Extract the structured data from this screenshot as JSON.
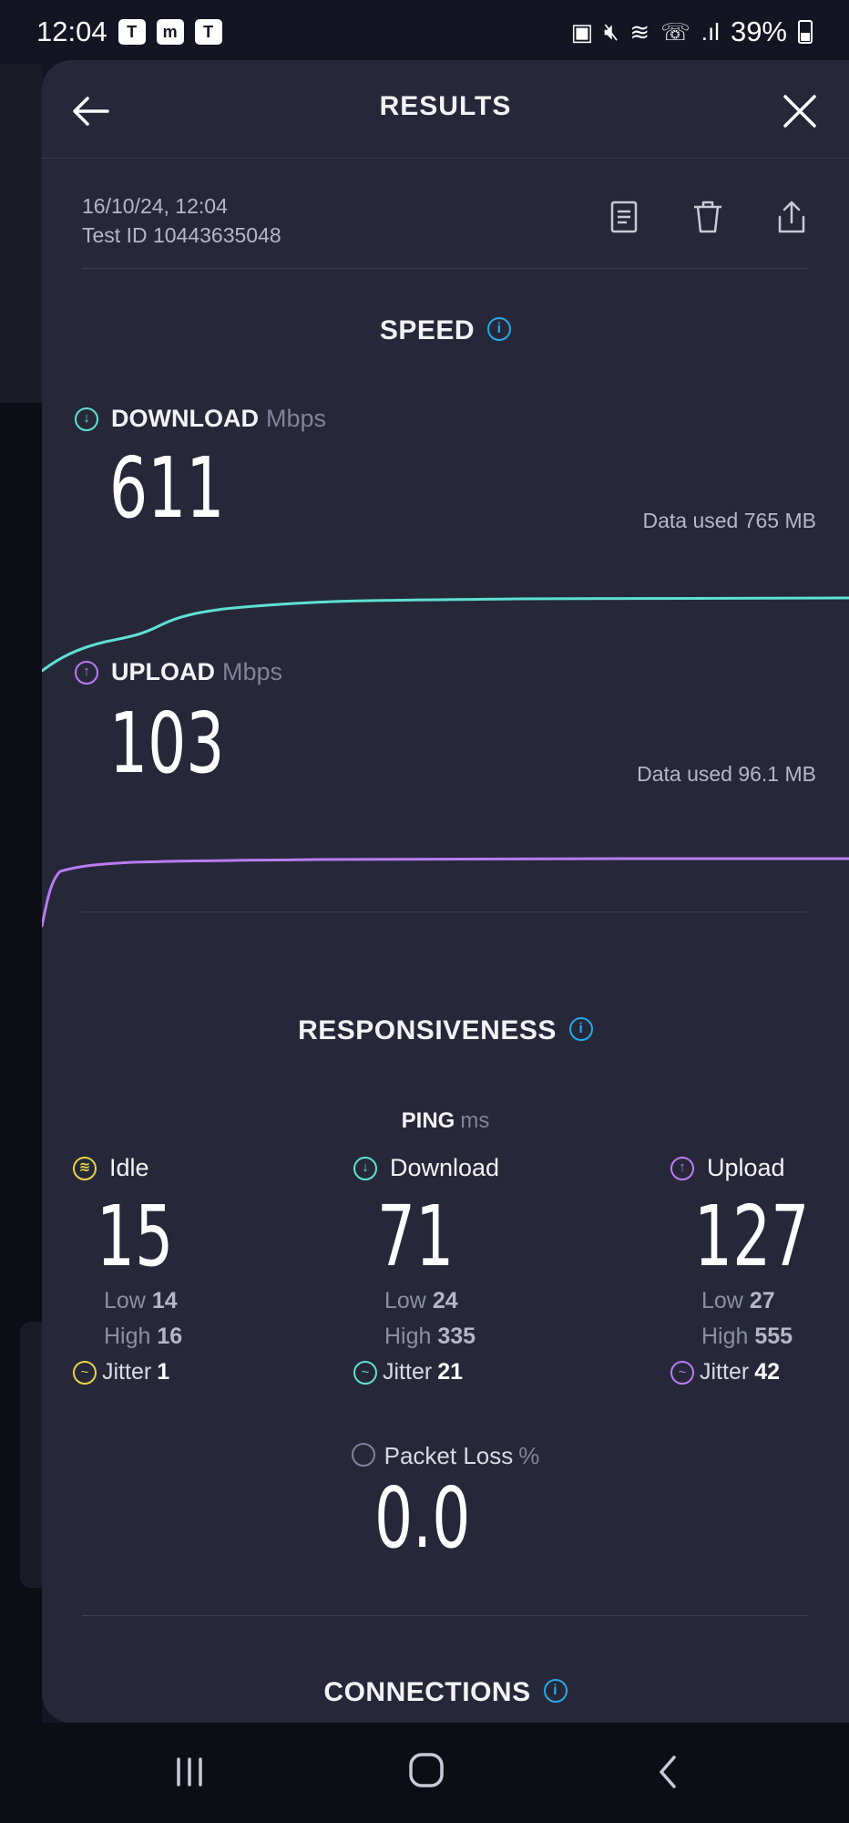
{
  "status_bar": {
    "time": "12:04",
    "apps": [
      "teams-icon",
      "m-app-icon",
      "teams-icon"
    ],
    "battery": "39%",
    "signal_text": ".ıl"
  },
  "header": {
    "title": "RESULTS"
  },
  "meta": {
    "datetime": "16/10/24, 12:04",
    "test_id": "Test ID 10443635048"
  },
  "speed": {
    "title": "SPEED",
    "download": {
      "label": "DOWNLOAD",
      "unit": "Mbps",
      "value": "611",
      "data_used": "Data used 765 MB",
      "color": "#5fe0d4"
    },
    "upload": {
      "label": "UPLOAD",
      "unit": "Mbps",
      "value": "103",
      "data_used": "Data used 96.1 MB",
      "color": "#b97cf2"
    }
  },
  "responsiveness": {
    "title": "RESPONSIVENESS",
    "ping_label": "PING",
    "ping_unit": "ms",
    "columns": [
      {
        "name": "Idle",
        "value": "15",
        "low_label": "Low",
        "low": "14",
        "high_label": "High",
        "high": "16",
        "jitter_label": "Jitter",
        "jitter": "1",
        "color": "#e8d34a"
      },
      {
        "name": "Download",
        "value": "71",
        "low_label": "Low",
        "low": "24",
        "high_label": "High",
        "high": "335",
        "jitter_label": "Jitter",
        "jitter": "21",
        "color": "#5fe0d4"
      },
      {
        "name": "Upload",
        "value": "127",
        "low_label": "Low",
        "low": "27",
        "high_label": "High",
        "high": "555",
        "jitter_label": "Jitter",
        "jitter": "42",
        "color": "#b97cf2"
      }
    ],
    "packet_loss_label": "Packet Loss",
    "packet_loss_unit": "%",
    "packet_loss_value": "0.0"
  },
  "connections": {
    "title": "CONNECTIONS"
  },
  "icons": {
    "info": "i",
    "download_arrow": "↓",
    "upload_arrow": "↑",
    "idle": "≋"
  }
}
